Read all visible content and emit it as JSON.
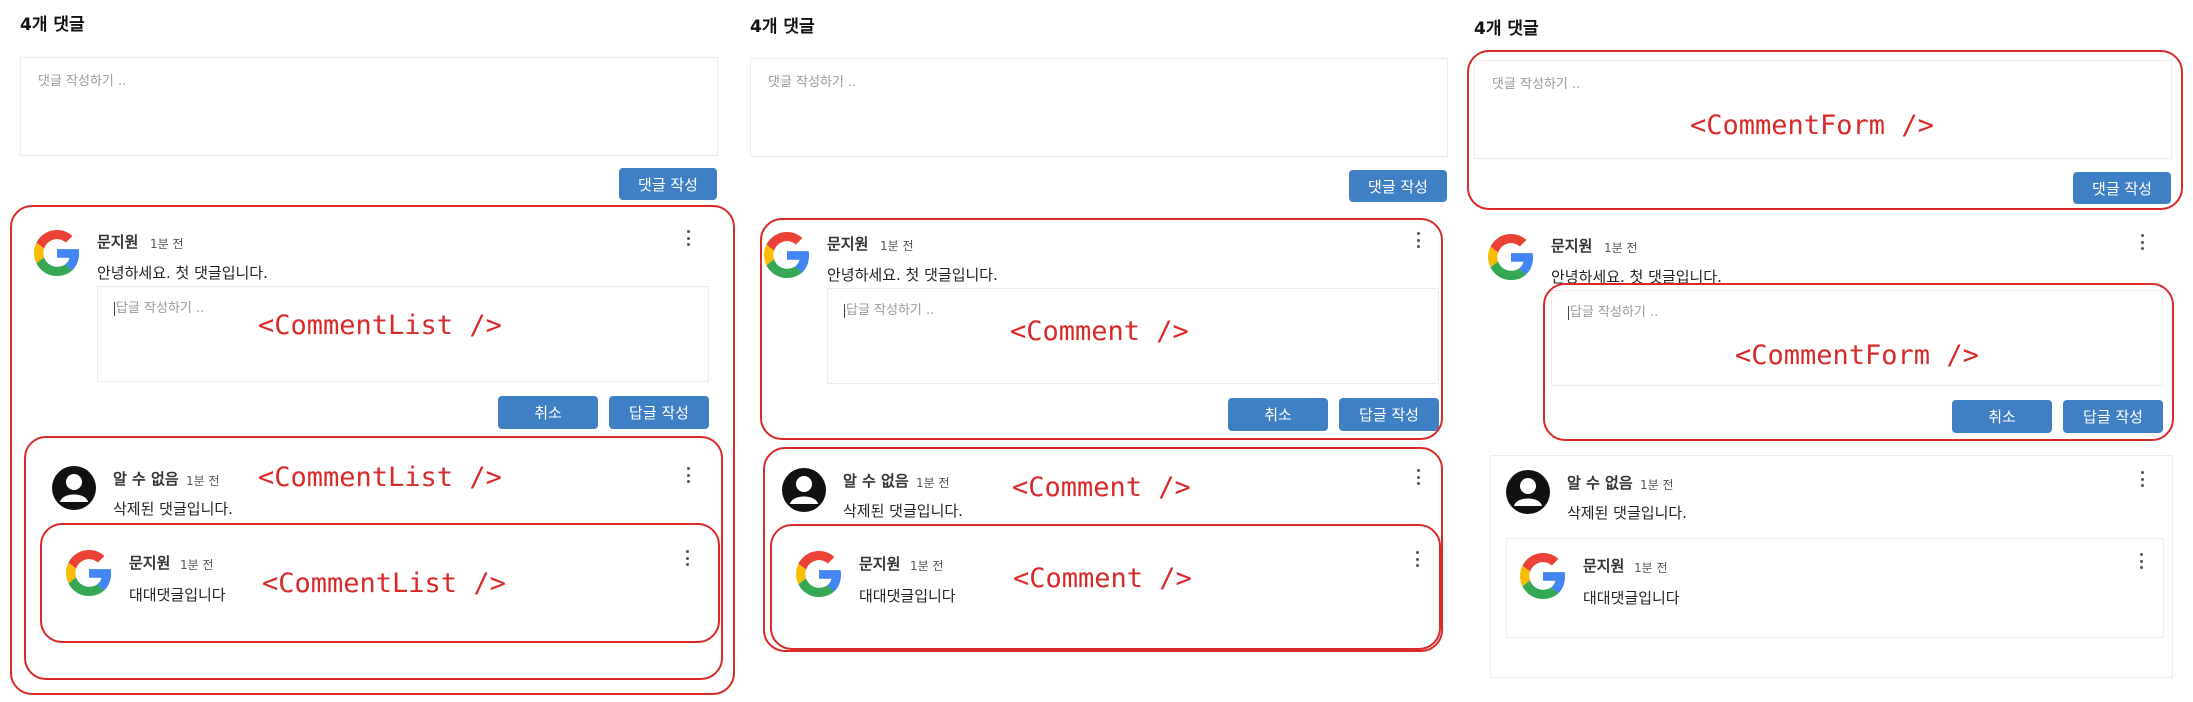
{
  "comment_count": "4개 댓글",
  "form": {
    "placeholder": "댓글 작성하기 ..",
    "submit": "댓글 작성"
  },
  "reply_form": {
    "placeholder": "답글 작성하기 ..",
    "cancel": "취소",
    "submit": "답글 작성"
  },
  "comments": [
    {
      "author": "문지원",
      "time": "1분 전",
      "text": "안녕하세요. 첫 댓글입니다.",
      "avatar": "google-icon"
    },
    {
      "author": "알 수 없음",
      "time": "1분 전",
      "text": "삭제된 댓글입니다.",
      "avatar": "user-silhouette-icon"
    },
    {
      "author": "문지원",
      "time": "1분 전",
      "text": "대대댓글입니다",
      "avatar": "google-icon"
    }
  ],
  "annotations": {
    "comment_list": "<CommentList />",
    "comment": "<Comment />",
    "comment_form": "<CommentForm />"
  },
  "colors": {
    "button": "#3f7fc4",
    "annotation": "#d92a2a"
  }
}
